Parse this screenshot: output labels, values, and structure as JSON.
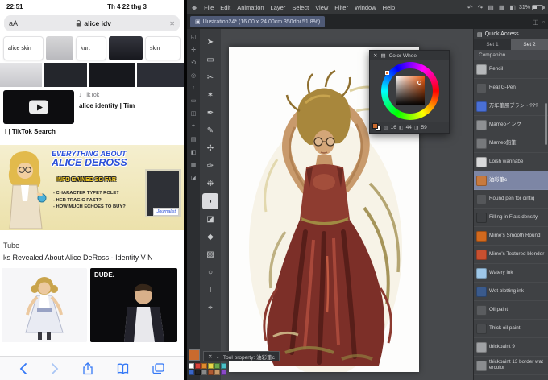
{
  "status": {
    "time": "22:51",
    "date": "Th 4 22 thg 3"
  },
  "safari": {
    "reader_button": "aA",
    "address": "alice idv",
    "clear_button": "✕",
    "suggestions": [
      "alice skin",
      "kurt",
      "skin"
    ],
    "video": {
      "source": "TikTok",
      "title_line1": "alice identity | Tim",
      "title_line2": "l | TikTok Search"
    },
    "infographic": {
      "title_line1": "EVERYTHING ABOUT",
      "title_line2": "ALICE DEROSS",
      "subtitle": "INFO GAINED SO FAR",
      "bullets": [
        "- CHARACTER TYPE? ROLE?",
        "- HER TRAGIC PAST?",
        "- HOW MUCH ECHOES TO BUY?"
      ],
      "badge": "Journalist"
    },
    "result_site": "Tube",
    "result_title": "ks Revealed About Alice DeRoss - Identity V N",
    "dude_caption": "DUDE."
  },
  "csp": {
    "menus": [
      "File",
      "Edit",
      "Animation",
      "Layer",
      "Select",
      "View",
      "Filter",
      "Window",
      "Help"
    ],
    "battery": "31%",
    "doc_tab": "Illustration24* (16.00 x 24.00cm 350dpi 51.8%)",
    "color_wheel": {
      "title": "Color Wheel",
      "values": [
        "16",
        "44",
        "59"
      ],
      "selected_color": "#c96a2e"
    },
    "tool_property": "Tool property: 油彩筆c",
    "quick_access": {
      "title": "Quick Access",
      "tabs": [
        "Set 1",
        "Set 2"
      ],
      "active_tab": 1,
      "section": "Companion",
      "selected_index": 6,
      "brushes": [
        {
          "label": "Pencil",
          "icon_color": "#b6b8ba"
        },
        {
          "label": "Real G-Pen",
          "icon_color": "#55575a"
        },
        {
          "label": "万年筆風ブラシ・???",
          "icon_color": "#4a6fd4"
        },
        {
          "label": "Mameoインク",
          "icon_color": "#8e9093"
        },
        {
          "label": "Mameo鉛筆",
          "icon_color": "#77797c"
        },
        {
          "label": "Loish wannabe",
          "icon_color": "#d8d9da"
        },
        {
          "label": "油彩筆c",
          "icon_color": "#c87a3e"
        },
        {
          "label": "Round pen for cintiq",
          "icon_color": "#55575a"
        },
        {
          "label": "Filling in Flats density",
          "icon_color": "#3e4043"
        },
        {
          "label": "Mime's Smooth Round",
          "icon_color": "#d2691e"
        },
        {
          "label": "Mime's Textured blender",
          "icon_color": "#c85030"
        },
        {
          "label": "Watery ink",
          "icon_color": "#9ec7e8"
        },
        {
          "label": "Wet blotting ink",
          "icon_color": "#3a5a8c"
        },
        {
          "label": "Oil paint",
          "icon_color": "#5a5c5f"
        },
        {
          "label": "Thick oil paint",
          "icon_color": "#4a4c4f"
        },
        {
          "label": "thickpaint 9",
          "icon_color": "#a0a2a5"
        },
        {
          "label": "thickpaint 13 border wat ercolor",
          "icon_color": "#8a8c8f"
        }
      ]
    }
  }
}
